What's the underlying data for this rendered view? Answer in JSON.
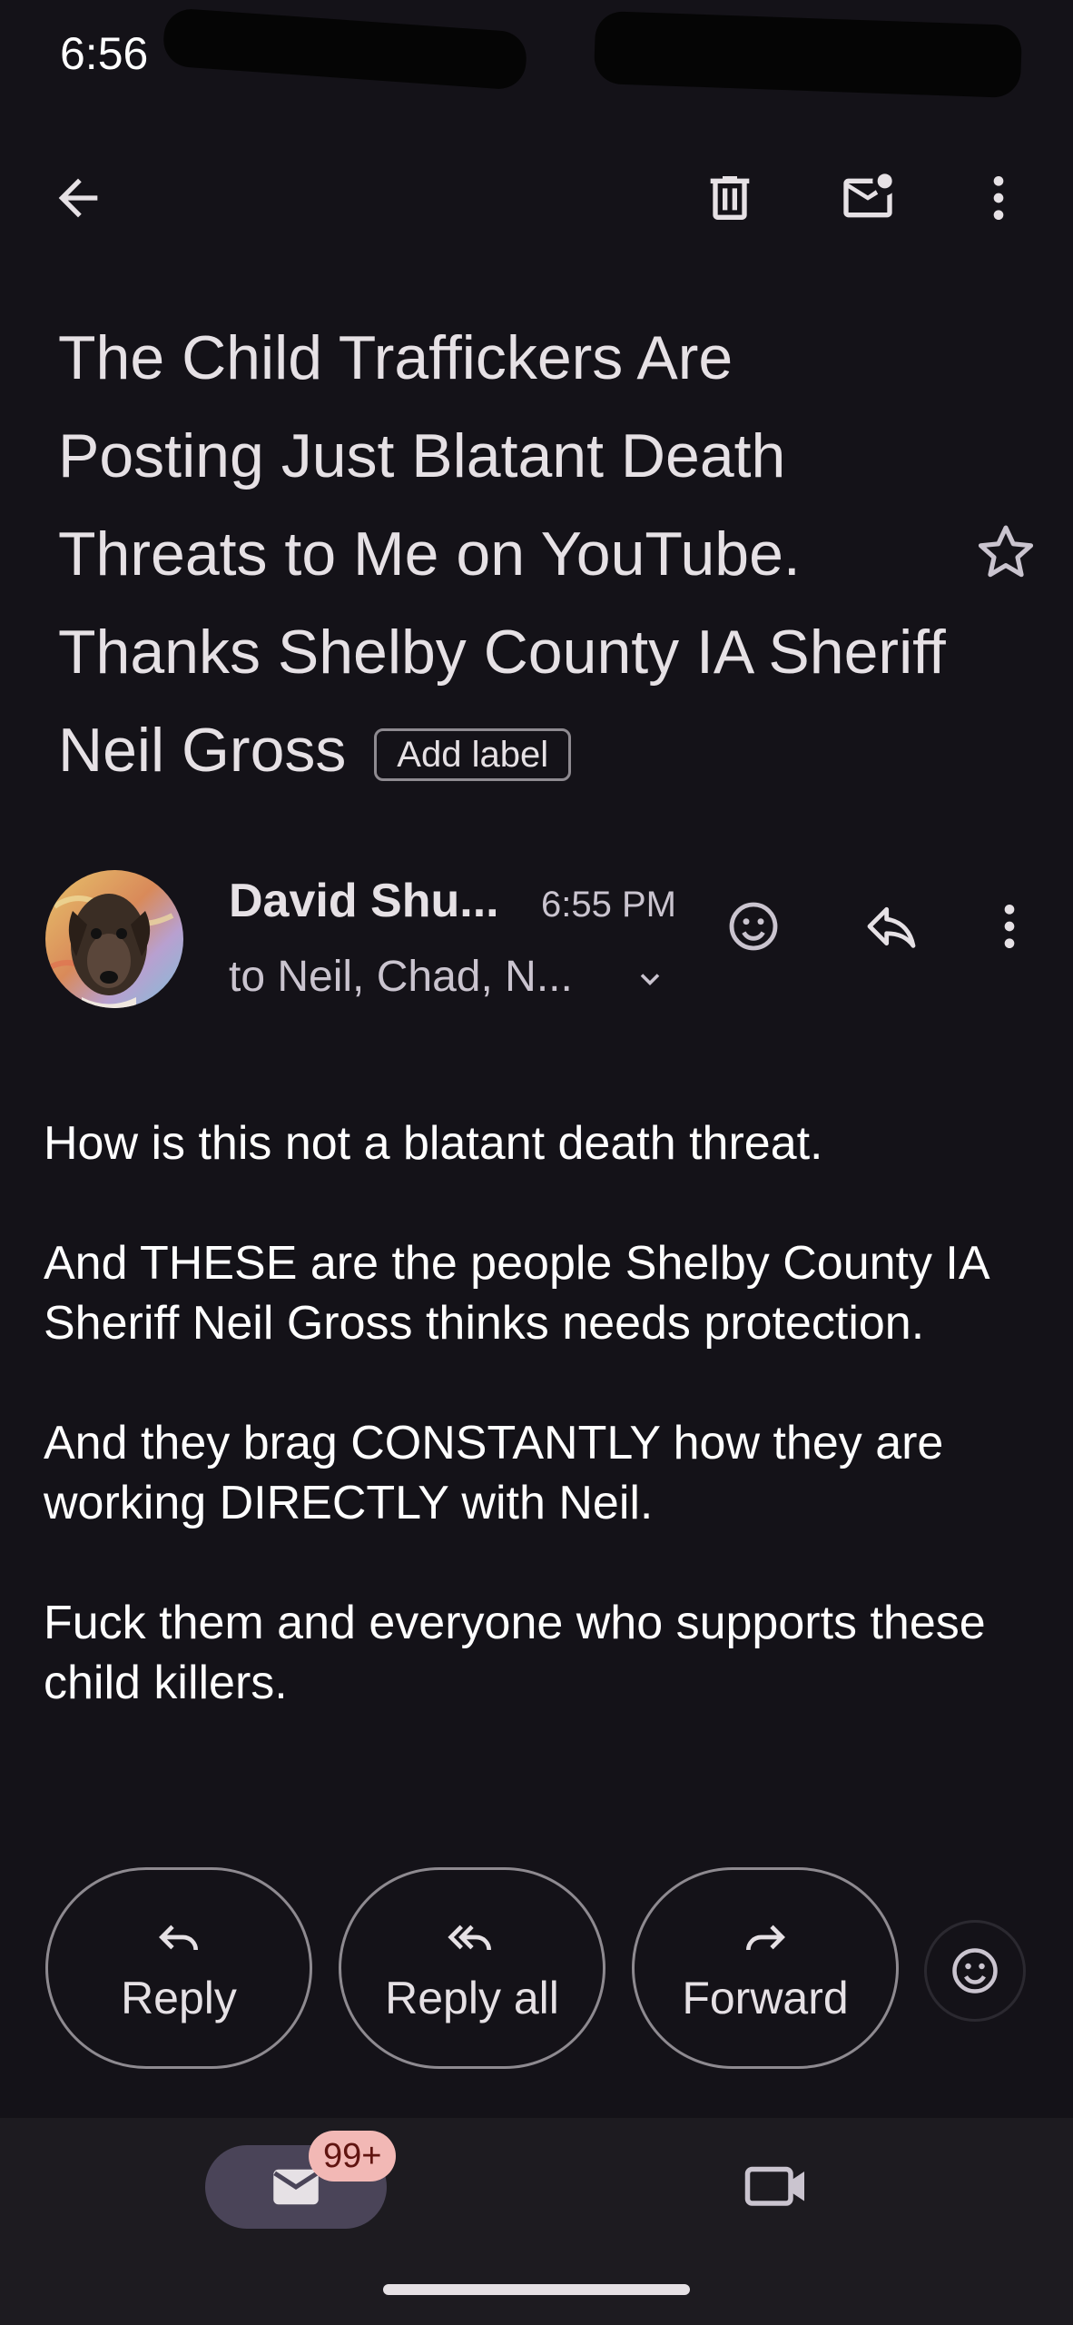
{
  "status_bar": {
    "time": "6:56"
  },
  "email": {
    "subject": "The Child Traffickers Are Posting Just Blatant Death Threats to Me on YouTube. Thanks Shelby County IA Sheriff Neil Gross",
    "add_label": "Add label",
    "sender": "David Shu...",
    "time": "6:55 PM",
    "recipients": "to Neil, Chad, N...",
    "body": [
      "How is this not a blatant death threat.",
      "And THESE are the people Shelby County IA Sheriff Neil Gross thinks needs protection.",
      "And they brag CONSTANTLY how they are working DIRECTLY with Neil.",
      "Fuck them and everyone who supports these child killers."
    ]
  },
  "actions": {
    "reply": "Reply",
    "reply_all": "Reply all",
    "forward": "Forward"
  },
  "bottom_nav": {
    "mail_badge": "99+"
  },
  "icons": [
    "back-arrow-icon",
    "delete-icon",
    "mark-unread-icon",
    "more-vert-icon",
    "star-icon",
    "emoji-icon",
    "reply-icon",
    "reply-all-icon",
    "forward-icon",
    "mail-icon",
    "video-icon"
  ],
  "colors": {
    "background": "#141218",
    "nav_background": "#1d1b20",
    "pill": "#4a4458",
    "badge": "#f2b8b5"
  }
}
